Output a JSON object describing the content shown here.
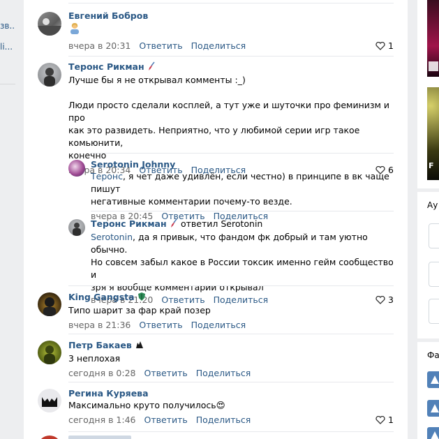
{
  "left_fragments": [
    "зв...",
    "li..."
  ],
  "comments": [
    {
      "id": "c1",
      "author": "Евгений Бобров",
      "badge": "person",
      "text_lines": [
        "🧑"
      ],
      "time": "вчера в 20:31",
      "reply": "Ответить",
      "share": "Поделиться",
      "likes": "1"
    },
    {
      "id": "c2",
      "author": "Теронс Рикман",
      "badge": "feather",
      "text_lines": [
        "Лучше бы я не открывал комменты :_)",
        "",
        "Люди просто сделали косплей, а тут уже и шуточки про феминизм и про",
        "как это развидеть. Неприятно, что у любимой серии игр такое комьюнити,",
        "конечно"
      ],
      "time": "вчера в 20:34",
      "reply": "Ответить",
      "share": "Поделиться",
      "likes": "6"
    },
    {
      "id": "c3",
      "author": "Serotonin Johnny",
      "mention": "Теронс",
      "text_lines": [
        ", я чет даже удивлён, если честно) в принципе в вк чаще пишут",
        "негативные комментарии почему-то везде."
      ],
      "time": "вчера в 20:45",
      "reply": "Ответить",
      "share": "Поделиться",
      "likes": ""
    },
    {
      "id": "c4",
      "author": "Теронс Рикман",
      "badge": "feather",
      "replied_to": "ответил Serotonin",
      "mention": "Serotonin",
      "text_lines": [
        ", да я привык, что фандом фк добрый и там уютно обычно.",
        "Но совсем забыл какое в России токсик именно гейм сообщество и",
        "зря я вообще комментарии открывал"
      ],
      "time": "вчера в 21:20",
      "reply": "Ответить",
      "share": "Поделиться",
      "likes": "3"
    },
    {
      "id": "c5",
      "author": "King Gangsta",
      "badge": "shield",
      "text_lines": [
        "Типо шарит за фар край позер"
      ],
      "time": "вчера в 21:36",
      "reply": "Ответить",
      "share": "Поделиться",
      "likes": ""
    },
    {
      "id": "c6",
      "author": "Петр Бакаев",
      "badge": "wolf",
      "text_lines": [
        "3 неплохая"
      ],
      "time": "сегодня в 0:28",
      "reply": "Ответить",
      "share": "Поделиться",
      "likes": ""
    },
    {
      "id": "c7",
      "author": "Регина Куряева",
      "badge": "",
      "text_lines": [
        "Максимально круто получилось😍"
      ],
      "time": "сегодня в 1:46",
      "reply": "Ответить",
      "share": "Поделиться",
      "likes": "1"
    }
  ],
  "right_col": {
    "label1": "Ау",
    "label2": "Фа",
    "cover_letter": "F"
  },
  "colors": {
    "link": "#2a5885",
    "meta": "#656565",
    "bg": "#edeef0",
    "accent": "#5181b8"
  }
}
